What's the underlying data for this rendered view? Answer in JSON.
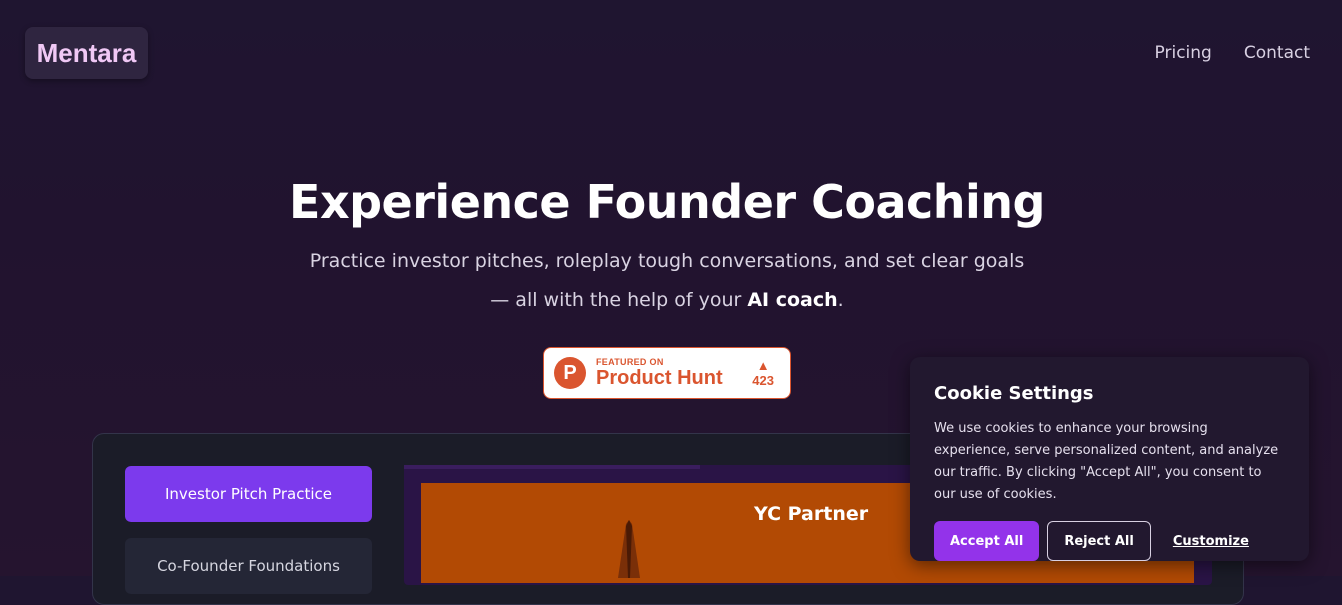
{
  "brand": {
    "logo_text": "Mentara"
  },
  "nav": {
    "items": [
      {
        "label": "Pricing"
      },
      {
        "label": "Contact"
      }
    ]
  },
  "hero": {
    "title": "Experience Founder Coaching",
    "subtitle_part1": "Practice investor pitches, roleplay tough conversations, and set clear goals — all with the help of your ",
    "subtitle_bold": "AI coach",
    "subtitle_end": "."
  },
  "product_hunt": {
    "logo_letter": "P",
    "featured_label": "FEATURED ON",
    "name": "Product Hunt",
    "votes": "423",
    "brand_color": "#da552f"
  },
  "demo": {
    "sidebar": [
      {
        "label": "Investor Pitch Practice",
        "active": true
      },
      {
        "label": "Co-Founder Foundations",
        "active": false
      }
    ],
    "video_title": "YC Partner"
  },
  "cookie": {
    "title": "Cookie Settings",
    "body": "We use cookies to enhance your browsing experience, serve personalized content, and analyze our traffic. By clicking \"Accept All\", you consent to our use of cookies.",
    "accept_label": "Accept All",
    "reject_label": "Reject All",
    "customize_label": "Customize"
  },
  "colors": {
    "accent": "#7c3aed",
    "accept": "#9333ea",
    "background": "#21132f"
  }
}
